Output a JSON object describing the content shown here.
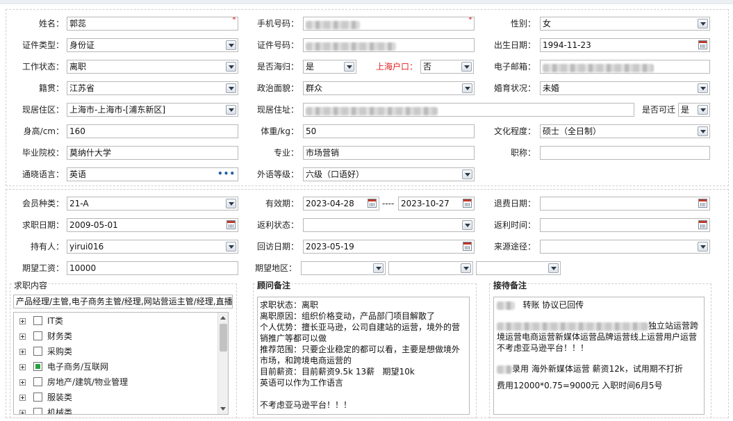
{
  "colors": {
    "required": "#e02020",
    "label_red": "#e02020",
    "check_on": "#22a33a",
    "border": "#b8b8b8"
  },
  "personal": {
    "name": {
      "label": "姓名：",
      "value": "郭蕊"
    },
    "phone": {
      "label": "手机号码：",
      "value": ""
    },
    "gender": {
      "label": "性别：",
      "value": "女"
    },
    "id_type": {
      "label": "证件类型：",
      "value": "身份证"
    },
    "id_number": {
      "label": "证件号码：",
      "value": ""
    },
    "birth_date": {
      "label": "出生日期：",
      "value": "1994-11-23"
    },
    "work_status": {
      "label": "工作状态：",
      "value": "离职"
    },
    "returnee": {
      "label": "是否海归：",
      "value": "是"
    },
    "shanghai_hukou": {
      "label": "上海户口：",
      "value": "否"
    },
    "email": {
      "label": "电子邮箱：",
      "value": ""
    },
    "native_place": {
      "label": "籍贯：",
      "value": "江苏省"
    },
    "political": {
      "label": "政治面貌：",
      "value": "群众"
    },
    "marital": {
      "label": "婚育状况：",
      "value": "未婚"
    },
    "residence_area": {
      "label": "现居住区：",
      "value": "上海市-上海市-[浦东新区]"
    },
    "address": {
      "label": "现居住址：",
      "value": ""
    },
    "commute": {
      "label": "是否可迁",
      "value": "是"
    },
    "height": {
      "label": "身高/cm：",
      "value": "160"
    },
    "weight": {
      "label": "体重/kg：",
      "value": "50"
    },
    "education": {
      "label": "文化程度：",
      "value": "硕士（全日制）"
    },
    "school": {
      "label": "毕业院校：",
      "value": "莫纳什大学"
    },
    "major": {
      "label": "专业：",
      "value": "市场营销"
    },
    "title": {
      "label": "职称：",
      "value": ""
    },
    "language": {
      "label": "通晓语言：",
      "value": "英语"
    },
    "language_level": {
      "label": "外语等级：",
      "value": "六级（口语好）"
    }
  },
  "membership": {
    "member_type": {
      "label": "会员种类：",
      "value": "21-A"
    },
    "valid_period": {
      "label": "有效期：",
      "from": "2023-04-28",
      "separator": "----",
      "to": "2023-10-27"
    },
    "refund_date": {
      "label": "退费日期：",
      "value": ""
    },
    "job_date": {
      "label": "求职日期：",
      "value": "2009-05-01"
    },
    "rebate_status": {
      "label": "返利状态：",
      "value": ""
    },
    "rebate_time": {
      "label": "返利时间：",
      "value": ""
    },
    "holder": {
      "label": "持有人：",
      "value": "yirui016"
    },
    "visit_date": {
      "label": "回访日期：",
      "value": "2023-05-19"
    },
    "source": {
      "label": "来源途径：",
      "value": ""
    },
    "expected_salary": {
      "label": "期望工资：",
      "value": "10000"
    },
    "expected_area": {
      "label": "期望地区：",
      "values": [
        "",
        "",
        ""
      ]
    }
  },
  "job_content": {
    "title": "求职内容",
    "summary": "产品经理/主管,电子商务主管/经理,网站营运主管/经理,直播",
    "tree": [
      {
        "label": "IT类",
        "checked": false
      },
      {
        "label": "财务类",
        "checked": false
      },
      {
        "label": "采购类",
        "checked": false
      },
      {
        "label": "电子商务/互联网",
        "checked": true
      },
      {
        "label": "房地产/建筑/物业管理",
        "checked": false
      },
      {
        "label": "服装类",
        "checked": false
      },
      {
        "label": "机械类",
        "checked": false
      }
    ]
  },
  "advisor_notes": {
    "title": "顾问备注",
    "text": "求职状态：离职\n离职原因：组织价格变动，产品部门项目解散了\n个人优势：擅长亚马逊，公司自建站的运营，境外的营销推广等都可以做\n推荐范围：只要企业稳定的都可以看，主要是想做境外市场，和跨境电商运营的\n目前薪资：目前薪资9.5k 13薪   期望10k\n英语可以作为工作语言\n\n不考虑亚马逊平台！！！"
  },
  "reception_notes": {
    "title": "接待备注",
    "line1": "转账   协议已回传",
    "line2": "独立站运营跨境运营电商运营新媒体运营品牌运营线上运营用户运营",
    "line3": "不考虑亚马逊平台！！！",
    "line4": "录用   海外新媒体运营   薪资12k，试用期不打折",
    "line5": "费用12000*0.75=9000元   入职时间6月5号"
  }
}
